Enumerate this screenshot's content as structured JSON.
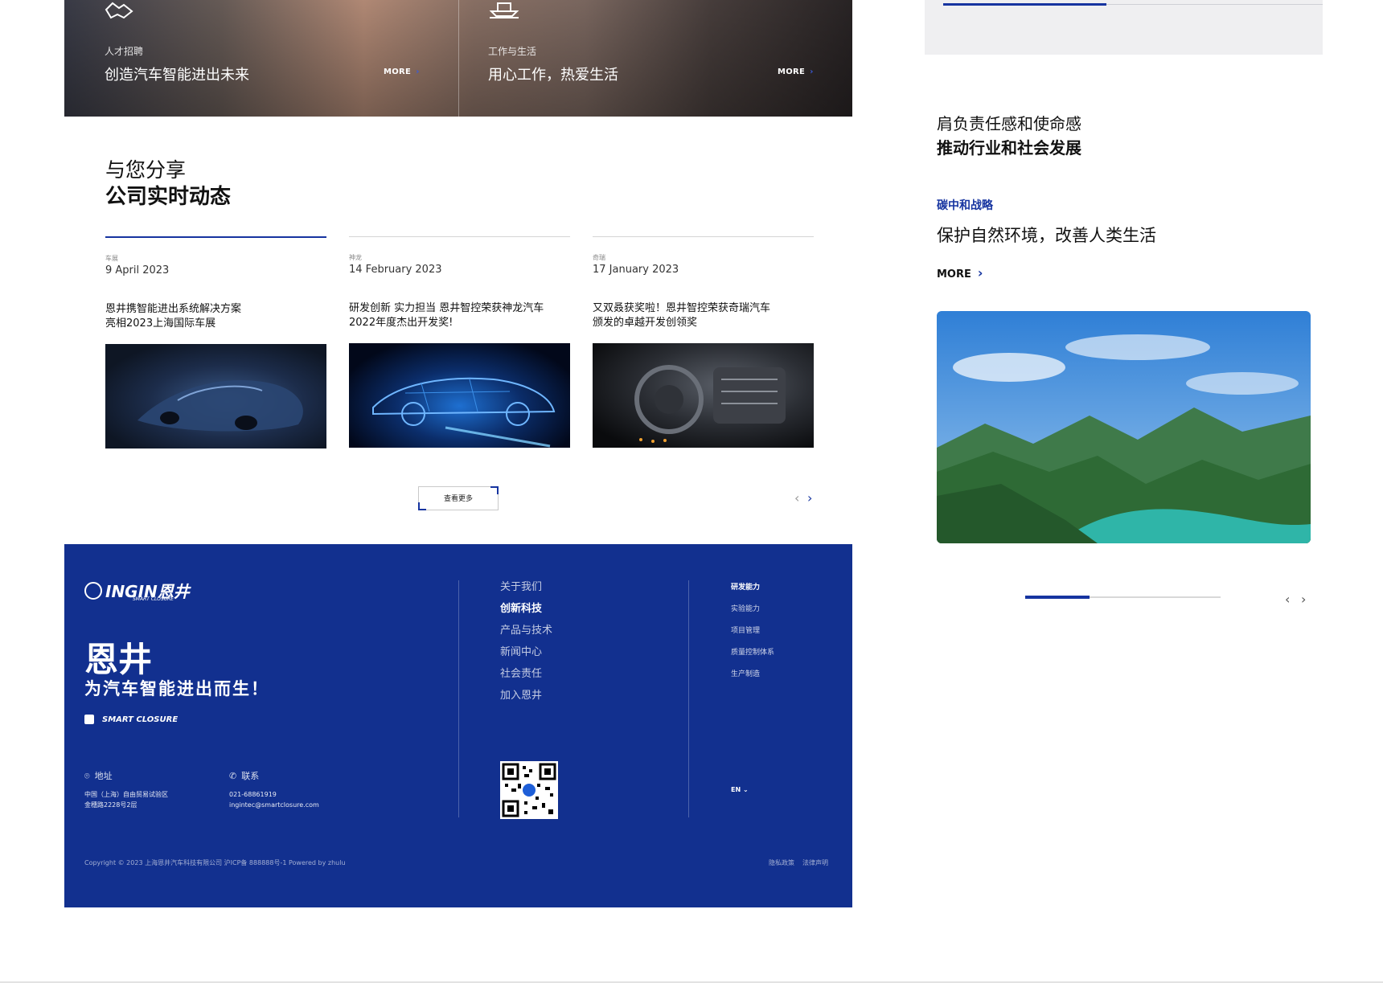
{
  "banner": {
    "tiles": [
      {
        "icon": "handshake-icon",
        "subtitle": "人才招聘",
        "title": "创造汽车智能进出未来",
        "more": "MORE"
      },
      {
        "icon": "boat-icon",
        "subtitle": "工作与生活",
        "title": "用心工作，热爱生活",
        "more": "MORE"
      }
    ]
  },
  "news": {
    "subtitle": "与您分享",
    "title": "公司实时动态",
    "cards": [
      {
        "tag": "车展",
        "date": "9 April 2023",
        "headline": "恩井携智能进出系统解决方案\n亮相2023上海国际车展",
        "image": "sports-car-dark-blue"
      },
      {
        "tag": "神龙",
        "date": "14 February 2023",
        "headline": "研发创新 实力担当 恩井智控荣获神龙汽车\n2022年度杰出开发奖!",
        "image": "wireframe-car-blue"
      },
      {
        "tag": "奇瑞",
        "date": "17 January 2023",
        "headline": "又双叒获奖啦！恩井智控荣获奇瑞汽车\n颁发的卓越开发创领奖",
        "image": "engine-parts-dark"
      }
    ],
    "view_more": "查看更多",
    "prev_icon": "chevron-left-icon",
    "next_icon": "chevron-right-icon"
  },
  "footer": {
    "logo": "INGIN恩井",
    "logo_sub": "SMART CLOSURE",
    "brand_cn": "恩井",
    "slogan": "为汽车智能进出而生！",
    "badge": "SMART CLOSURE",
    "address_label": "地址",
    "address": "中国（上海）自由贸易试验区\n金穗路2228号2层",
    "contact_label": "联系",
    "phone": "021-68861919",
    "email": "ingintec@smartclosure.com",
    "nav": [
      "关于我们",
      "创新科技",
      "产品与技术",
      "新闻中心",
      "社会责任",
      "加入恩井"
    ],
    "nav_active": 1,
    "subnav": [
      "研发能力",
      "实验能力",
      "项目管理",
      "质量控制体系",
      "生产制造"
    ],
    "subnav_active": 0,
    "lang": "EN",
    "copyright": "Copyright © 2023 上海恩井汽车科技有限公司 沪ICP备 888888号-1  Powered by zhulu",
    "privacy": "隐私政策",
    "legal": "法律声明",
    "bg_color": "#12308f"
  },
  "right_panel": {
    "heading_line1": "肩负责任感和使命感",
    "heading_line2": "推动行业和社会发展",
    "category": "碳中和战略",
    "title": "保护自然环境，改善人类生活",
    "more": "MORE",
    "image": "green-mountains-river",
    "top_progress": 0.43,
    "progress": 0.33
  },
  "accent_color": "#1634a0"
}
